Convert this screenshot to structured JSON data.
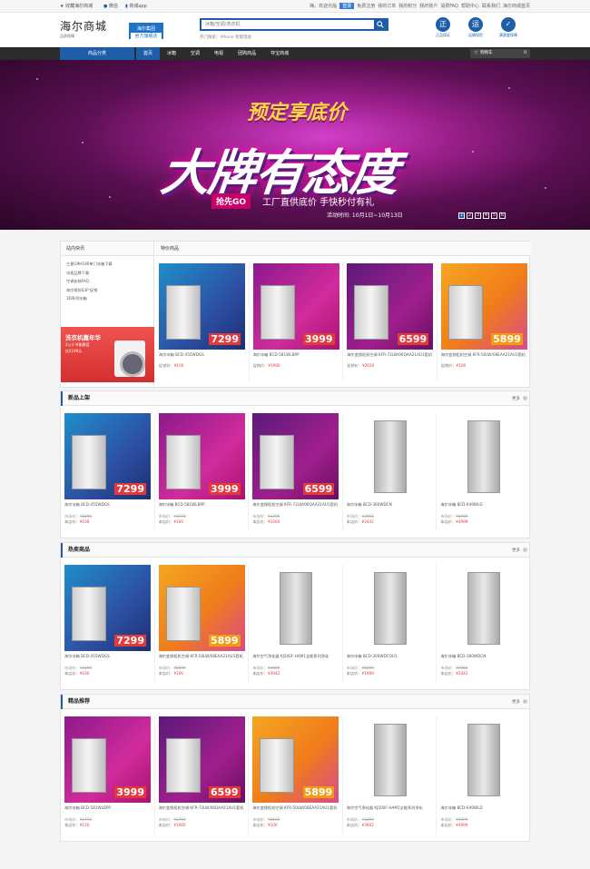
{
  "topbar": {
    "favorite": "收藏海尔商城",
    "links": [
      "微信",
      "商城app"
    ],
    "right": [
      "嗨，欢迎光临",
      "登录",
      "免费注册",
      "我的订单",
      "我的积分",
      "我的账户",
      "消费FAQ",
      "帮助中心",
      "联系我们",
      "海尔商城首页"
    ]
  },
  "header": {
    "logo_title": "海尔商城",
    "logo_sub": "品质保障",
    "badge_top": "海尔集团",
    "badge_bottom": "官方旗舰店",
    "search_placeholder": "冰箱/空调/洗衣机",
    "hot_label": "热门搜索：",
    "hot_items": "iPhone  智能电视",
    "services": [
      {
        "icon": "正",
        "label": "正品保证"
      },
      {
        "icon": "运",
        "label": "运输保险"
      },
      {
        "icon": "✓",
        "label": "满意度保障"
      }
    ]
  },
  "nav": {
    "category": "商品分类",
    "items": [
      "首页",
      "冰箱",
      "空调",
      "电视",
      "团购商品",
      "夺宝商城"
    ],
    "cart": "购物车",
    "cart_count": "0"
  },
  "banner": {
    "pre": "预定享底价",
    "big": "大牌有态度",
    "go": "抢先GO",
    "slogan": "工厂直供底价 手快秒付有礼",
    "date": "活动时间: 10月1日~10月13日",
    "dots": [
      "1",
      "2",
      "3",
      "4",
      "5",
      "6"
    ]
  },
  "hot_news": {
    "title": "站内快讯",
    "items": [
      "三星G9H180单门冰箱下载",
      "冰柜品牌下载",
      "空调安装FAQ",
      "海尔缤纷S3P 促销",
      "3D系列冰箱"
    ],
    "promo_title": "洗衣机嘉年华",
    "promo_sub": "2公斤节能静音",
    "promo_price": "仅2199元"
  },
  "special": {
    "title": "特价商品",
    "cards": [
      {
        "name": "海尔冰箱 BCD-455WDGS",
        "sp_label": "促销价：",
        "price": "¥100",
        "img": "im-blue",
        "tag": "7299"
      },
      {
        "name": "海尔冰箱 BCD-581WLBPP",
        "sp_label": "促销价：",
        "price": "¥1000",
        "img": "im-pink",
        "tag": "3999"
      },
      {
        "name": "海尔变频柜机空调 KFR-72LW/06QAA21AU1套机",
        "sp_label": "促销价：",
        "price": "¥2020",
        "img": "im-purple",
        "tag": "6599"
      },
      {
        "name": "海尔变频柜机空调 KFR-50LW/08EAA21AU1套机",
        "sp_label": "促销价：",
        "price": "¥100",
        "img": "im-orange",
        "tag": "5899"
      }
    ]
  },
  "sections": [
    {
      "title": "新品上架",
      "more": "更多",
      "cards": [
        {
          "name": "海尔冰箱 BCD-455WDGS",
          "mp": "¥2299",
          "sp": "¥100",
          "img": "im-blue",
          "tag": "7299"
        },
        {
          "name": "海尔冰箱 BCD-581WLBPP",
          "mp": "¥1774",
          "sp": "¥100",
          "img": "im-pink",
          "tag": "3999"
        },
        {
          "name": "海尔变频柜机空调 KFR-72LW/06QAA21AU1套机",
          "mp": "¥1799",
          "sp": "¥1000",
          "img": "im-purple",
          "tag": "6599"
        },
        {
          "name": "海尔冰箱 BCD-360WDCN",
          "mp": "¥2950",
          "sp": "¥2442",
          "img": "im-white",
          "tag": ""
        },
        {
          "name": "海尔冰箱 BCD-649WLD",
          "mp": "¥4999",
          "sp": "¥4999",
          "img": "im-white",
          "tag": ""
        }
      ]
    },
    {
      "title": "热卖商品",
      "more": "更多",
      "cards": [
        {
          "name": "海尔冰箱 BCD-455WDGS",
          "mp": "¥2299",
          "sp": "¥100",
          "img": "im-blue",
          "tag": "7299"
        },
        {
          "name": "海尔变频柜机空调 KFR-50LW/08EAA21AU1套机",
          "mp": "¥5699",
          "sp": "¥100",
          "img": "im-orange",
          "tag": "5899"
        },
        {
          "name": "海尔空气净化器 KJ500F-HAM1全能系列净化",
          "mp": "¥4099",
          "sp": "¥3942",
          "img": "im-white",
          "tag": ""
        },
        {
          "name": "海尔冰箱 BCD-300WDCOU1",
          "mp": "¥2099",
          "sp": "¥1999",
          "img": "im-white",
          "tag": ""
        },
        {
          "name": "海尔冰箱 BCD-360WDCN",
          "mp": "¥2950",
          "sp": "¥2442",
          "img": "im-white",
          "tag": ""
        }
      ]
    },
    {
      "title": "精品推荐",
      "more": "更多",
      "cards": [
        {
          "name": "海尔冰箱 BCD-581WLBPP",
          "mp": "¥1774",
          "sp": "¥150",
          "img": "im-pink",
          "tag": "3999"
        },
        {
          "name": "海尔变频柜机空调 KFR-72LW/06QAA21AU1套机",
          "mp": "¥1799",
          "sp": "¥1000",
          "img": "im-purple",
          "tag": "6599"
        },
        {
          "name": "海尔变频柜机空调 KFR-50LW/08EAA21AU1套机",
          "mp": "¥5699",
          "sp": "¥100",
          "img": "im-orange",
          "tag": "5899"
        },
        {
          "name": "海尔空气净化器 KJ500F-HAM1全能系列净化",
          "mp": "¥4299",
          "sp": "¥3942",
          "img": "im-white",
          "tag": ""
        },
        {
          "name": "海尔冰箱 BCD-649WLD",
          "mp": "¥4999",
          "sp": "¥4999",
          "img": "im-white",
          "tag": ""
        }
      ]
    }
  ],
  "labels": {
    "market": "市场价：",
    "shop": "本店价："
  }
}
